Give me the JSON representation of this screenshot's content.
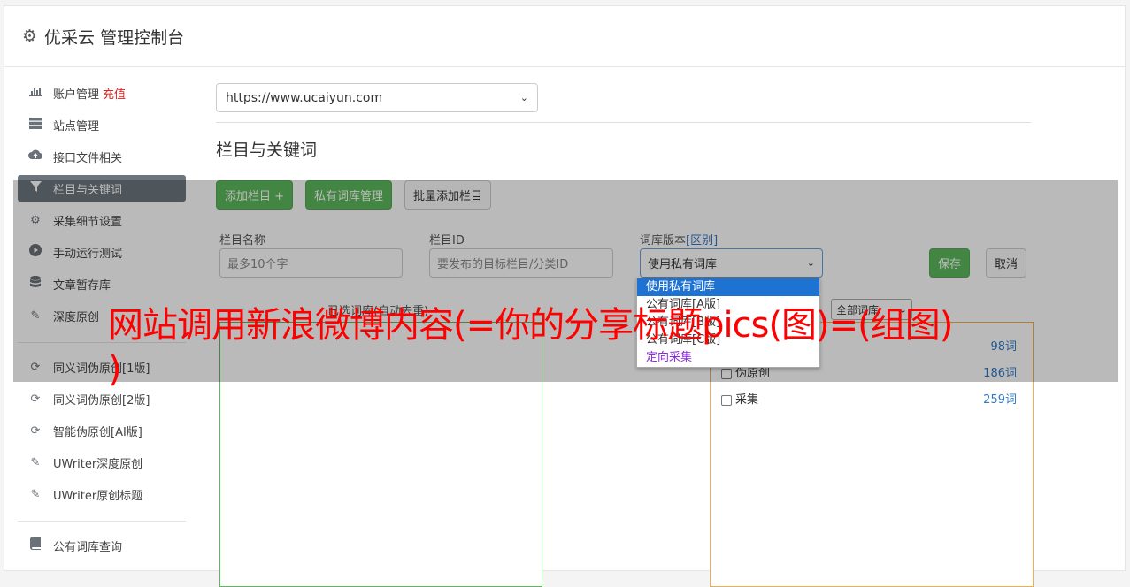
{
  "header": {
    "title": "优采云 管理控制台"
  },
  "sidebar": {
    "group1": [
      {
        "label": "账户管理",
        "extra": "充值",
        "icon": "bar-chart-icon"
      },
      {
        "label": "站点管理",
        "icon": "server-icon"
      },
      {
        "label": "接口文件相关",
        "icon": "cloud-upload-icon"
      },
      {
        "label": "栏目与关键词",
        "icon": "filter-icon",
        "active": true
      },
      {
        "label": "采集细节设置",
        "icon": "cogs-icon"
      },
      {
        "label": "手动运行测试",
        "icon": "play-circle-icon"
      },
      {
        "label": "文章暂存库",
        "icon": "database-icon"
      },
      {
        "label": "深度原创",
        "icon": "edit-icon"
      }
    ],
    "group2": [
      {
        "label": "同义词伪原创[1版]",
        "icon": "refresh-icon"
      },
      {
        "label": "同义词伪原创[2版]",
        "icon": "refresh-icon"
      },
      {
        "label": "智能伪原创[AI版]",
        "icon": "refresh-icon"
      },
      {
        "label": "UWriter深度原创",
        "icon": "edit-icon"
      },
      {
        "label": "UWriter原创标题",
        "icon": "edit-icon"
      }
    ],
    "group3": [
      {
        "label": "公有词库查询",
        "icon": "book-icon"
      }
    ]
  },
  "main": {
    "site_select": "https://www.ucaiyun.com",
    "section_title": "栏目与关键词",
    "buttons": {
      "add": "添加栏目 +",
      "private_lib": "私有词库管理",
      "batch_add": "批量添加栏目"
    },
    "fields": {
      "name_label": "栏目名称",
      "name_placeholder": "最多10个字",
      "id_label": "栏目ID",
      "id_placeholder": "要发布的目标栏目/分类ID",
      "version_label": "词库版本",
      "version_link": "[区别]",
      "version_value": "使用私有词库"
    },
    "save": "保存",
    "cancel": "取消",
    "dropdown_options": [
      "使用私有词库",
      "公有词库[A版]",
      "公有词库[B版]",
      "公有词库[C版]",
      "定向采集"
    ],
    "selected_words_label": "已选词库(自动去重)",
    "filter_select": "全部词库",
    "word_list": [
      {
        "name": "伪原创",
        "count": "186词"
      },
      {
        "name": "采集",
        "count": "259词"
      }
    ],
    "partial_count": "98词"
  },
  "watermark": {
    "line1": "网站调用新浪微博内容(=你的分享标题pics(图)=(组图)",
    "line2": ")"
  }
}
